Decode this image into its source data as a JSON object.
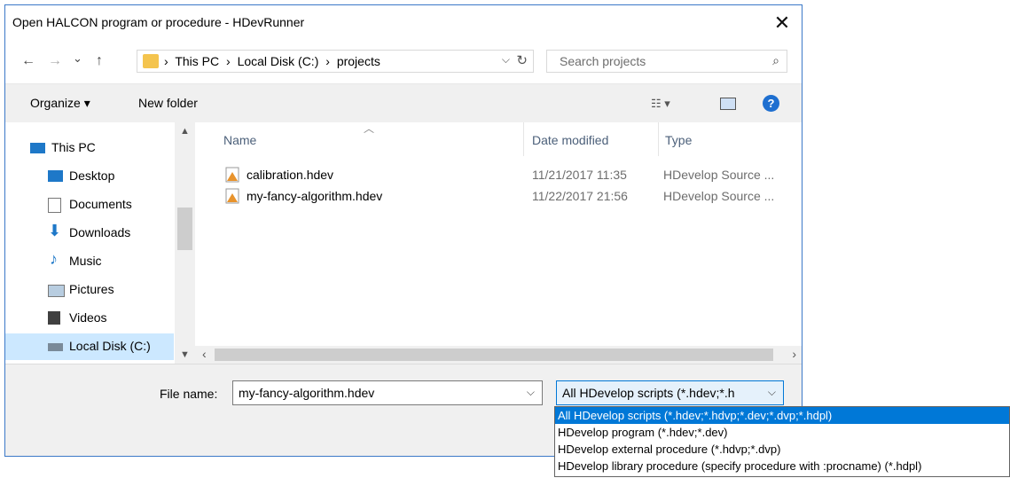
{
  "window": {
    "title": "Open HALCON program or procedure - HDevRunner",
    "close_glyph": "✕"
  },
  "nav": {
    "back_glyph": "←",
    "forward_glyph": "→",
    "recent_glyph": "⌄",
    "up_glyph": "↑",
    "breadcrumb": [
      "This PC",
      "Local Disk (C:)",
      "projects"
    ],
    "separator": "›",
    "search_placeholder": "Search projects"
  },
  "toolbar": {
    "organize_label": "Organize ▾",
    "new_folder_label": "New folder"
  },
  "sidebar": {
    "items": [
      {
        "label": "This PC",
        "icon": "computer-icon",
        "color": "#1e78c8"
      },
      {
        "label": "Desktop",
        "icon": "desktop-icon",
        "color": "#1e78c8"
      },
      {
        "label": "Documents",
        "icon": "documents-icon",
        "color": "#9aa0a6"
      },
      {
        "label": "Downloads",
        "icon": "downloads-icon",
        "color": "#1e78c8"
      },
      {
        "label": "Music",
        "icon": "music-icon",
        "color": "#1e78c8"
      },
      {
        "label": "Pictures",
        "icon": "pictures-icon",
        "color": "#6d8fb0"
      },
      {
        "label": "Videos",
        "icon": "videos-icon",
        "color": "#404040"
      },
      {
        "label": "Local Disk (C:)",
        "icon": "drive-icon",
        "color": "#7a8a99",
        "selected": true
      }
    ]
  },
  "files": {
    "columns": [
      "Name",
      "Date modified",
      "Type"
    ],
    "rows": [
      {
        "name": "calibration.hdev",
        "date": "11/21/2017 11:35",
        "type": "HDevelop Source ..."
      },
      {
        "name": "my-fancy-algorithm.hdev",
        "date": "11/22/2017 21:56",
        "type": "HDevelop Source ..."
      }
    ]
  },
  "bottom": {
    "file_name_label": "File name:",
    "file_name_value": "my-fancy-algorithm.hdev",
    "file_type_value": "All HDevelop scripts (*.hdev;*.h"
  },
  "filetype_dropdown": {
    "options": [
      "All HDevelop scripts (*.hdev;*.hdvp;*.dev;*.dvp;*.hdpl)",
      "HDevelop program (*.hdev;*.dev)",
      "HDevelop external procedure (*.hdvp;*.dvp)",
      "HDevelop library procedure (specify procedure with :procname) (*.hdpl)"
    ],
    "selected_index": 0
  },
  "colors": {
    "accent": "#0078d7",
    "selection_bg": "#cce8ff",
    "border": "#3c79c8"
  }
}
